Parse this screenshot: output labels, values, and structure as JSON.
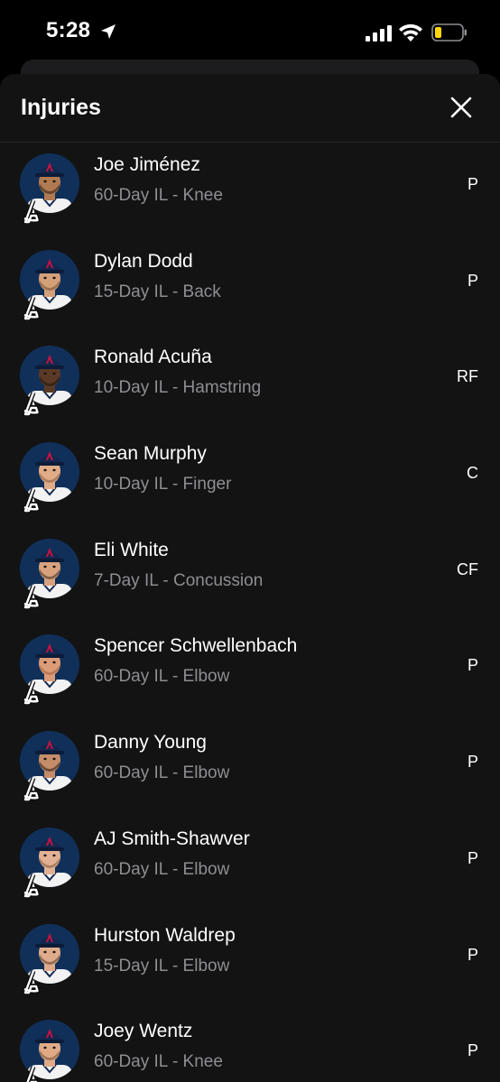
{
  "status_bar": {
    "time": "5:28"
  },
  "sheet": {
    "title": "Injuries",
    "close_icon": "close-icon"
  },
  "players": [
    {
      "name": "Joe Jiménez",
      "status": "60-Day IL - Knee",
      "position": "P",
      "skin": "#b07a52",
      "hair": "#2a1a10"
    },
    {
      "name": "Dylan Dodd",
      "status": "15-Day IL - Back",
      "position": "P",
      "skin": "#d4a07a",
      "hair": "#6b4a2a"
    },
    {
      "name": "Ronald Acuña",
      "status": "10-Day IL - Hamstring",
      "position": "RF",
      "skin": "#5a3a26",
      "hair": "#1a120c"
    },
    {
      "name": "Sean Murphy",
      "status": "10-Day IL - Finger",
      "position": "C",
      "skin": "#e0ac88",
      "hair": "#8a5a34"
    },
    {
      "name": "Eli White",
      "status": "7-Day IL - Concussion",
      "position": "CF",
      "skin": "#d8a27e",
      "hair": "#3a2a1c"
    },
    {
      "name": "Spencer Schwellenbach",
      "status": "60-Day IL - Elbow",
      "position": "P",
      "skin": "#dc9c78",
      "hair": "#a0603a"
    },
    {
      "name": "Danny Young",
      "status": "60-Day IL - Elbow",
      "position": "P",
      "skin": "#c48c68",
      "hair": "#2a1a10"
    },
    {
      "name": "AJ Smith-Shawver",
      "status": "60-Day IL - Elbow",
      "position": "P",
      "skin": "#e2b092",
      "hair": "#7a5a3a"
    },
    {
      "name": "Hurston Waldrep",
      "status": "15-Day IL - Elbow",
      "position": "P",
      "skin": "#deac8c",
      "hair": "#5a3a22"
    },
    {
      "name": "Joey Wentz",
      "status": "60-Day IL - Knee",
      "position": "P",
      "skin": "#e0aa88",
      "hair": "#6a4a2a"
    }
  ],
  "colors": {
    "background": "#000000",
    "sheet": "#131313",
    "secondary_text": "#8e8e93",
    "avatar_bg": "#10305a",
    "cap": "#13274f",
    "cap_logo": "#ce1141"
  }
}
